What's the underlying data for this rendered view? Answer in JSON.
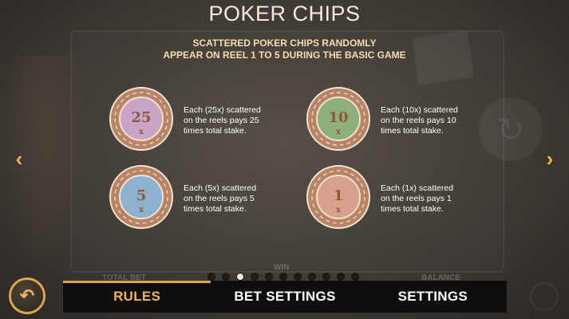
{
  "header": {
    "title": "POKER CHIPS",
    "subtitle_line1": "SCATTERED POKER CHIPS RANDOMLY",
    "subtitle_line2": "APPEAR ON REEL 1 TO 5 DURING THE BASIC GAME"
  },
  "chips": [
    {
      "value": "25",
      "desc_line1": "Each (25x) scattered",
      "desc_line2": "on the reels pays 25",
      "desc_line3": "times total stake.",
      "color_outer": "#b98466",
      "color_inner": "#c9a4c7"
    },
    {
      "value": "10",
      "desc_line1": "Each (10x) scattered",
      "desc_line2": "on the reels pays 10",
      "desc_line3": "times total stake.",
      "color_outer": "#b98466",
      "color_inner": "#8db07a"
    },
    {
      "value": "5",
      "desc_line1": "Each (5x) scattered",
      "desc_line2": "on the reels pays 5",
      "desc_line3": "times total stake.",
      "color_outer": "#b98466",
      "color_inner": "#8cb2cf"
    },
    {
      "value": "1",
      "desc_line1": "Each (1x) scattered",
      "desc_line2": "on the reels pays 1",
      "desc_line3": "times total stake.",
      "color_outer": "#b98466",
      "color_inner": "#d9a18d"
    }
  ],
  "chip_text_color": "#8a5a3b",
  "chip_x_glyph": "x",
  "background_labels": {
    "total_bet": "TOTAL BET",
    "win": "WIN",
    "balance": "BALANCE"
  },
  "pager": {
    "total": 11,
    "active_index": 2
  },
  "tabs": [
    {
      "label": "RULES",
      "active": true
    },
    {
      "label": "BET SETTINGS",
      "active": false
    },
    {
      "label": "SETTINGS",
      "active": false
    }
  ],
  "icons": {
    "nav_left": "‹",
    "nav_right": "›",
    "back": "↶"
  },
  "colors": {
    "accent": "#e8b55a",
    "active_tab": "#f0b64e",
    "subtitle": "#f6dcae"
  }
}
